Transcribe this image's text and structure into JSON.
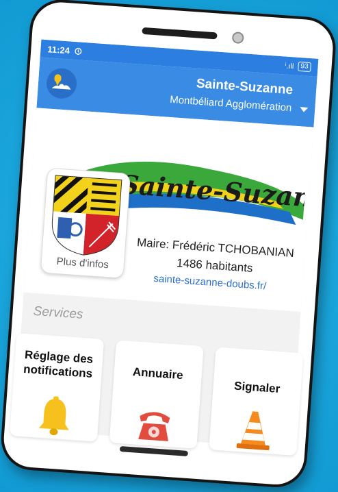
{
  "status_bar": {
    "time": "11:24",
    "signal_text": "ⁱ.ıll",
    "battery": "93"
  },
  "app_bar": {
    "town": "Sainte-Suzanne",
    "agglomeration": "Montbéliard Agglomération"
  },
  "hero": {
    "logo_text": "Sainte-Suzanne",
    "more_info": "Plus d'infos",
    "maire": "Maire: Frédéric TCHOBANIAN",
    "population": "1486 habitants",
    "website": "sainte-suzanne-doubs.fr/"
  },
  "services": {
    "title": "Services",
    "items": [
      {
        "label": "Réglage des notifications",
        "icon": "bell-icon"
      },
      {
        "label": "Annuaire",
        "icon": "telephone-icon"
      },
      {
        "label": "Signaler",
        "icon": "traffic-cone-icon"
      }
    ]
  },
  "colors": {
    "background": "#1aa7dd",
    "app_bar": "#3a8be3",
    "link": "#2a6fd0"
  }
}
